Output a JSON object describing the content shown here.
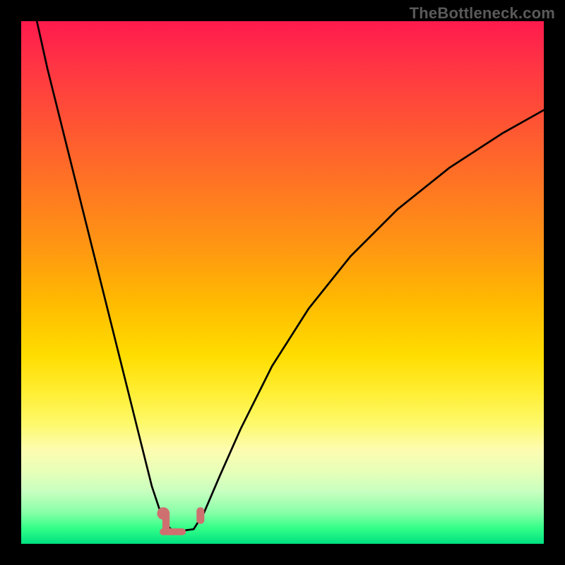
{
  "watermark": "TheBottleneck.com",
  "chart_data": {
    "type": "line",
    "title": "",
    "xlabel": "",
    "ylabel": "",
    "xlim": [
      0,
      100
    ],
    "ylim": [
      0,
      100
    ],
    "series": [
      {
        "name": "bottleneck-curve",
        "x": [
          3,
          5,
          8,
          11,
          14,
          17,
          20,
          23,
          25,
          27,
          28.5,
          30,
          31.5,
          33,
          35,
          38,
          42,
          48,
          55,
          63,
          72,
          82,
          92,
          100
        ],
        "y": [
          100,
          91,
          79,
          67,
          55,
          43,
          31,
          19,
          11,
          5,
          2.9,
          2.2,
          2.6,
          2.8,
          6,
          13,
          22,
          34,
          45,
          55,
          64,
          72,
          78.5,
          83
        ],
        "color": "#000000",
        "width": 2.7
      }
    ],
    "markers": [
      {
        "name": "left-edge-marker",
        "x": 27.2,
        "y": 5.8,
        "shape": "circle",
        "r": 1.2,
        "color": "#cf7070"
      },
      {
        "name": "bottom-horizontal",
        "x": 29.0,
        "y": 2.3,
        "shape": "bar-h",
        "w": 5.0,
        "h": 1.3,
        "color": "#cf7070"
      },
      {
        "name": "bottom-left-vertical",
        "x": 27.7,
        "y": 4.2,
        "shape": "bar-v",
        "w": 1.4,
        "h": 3.6,
        "color": "#cf7070"
      },
      {
        "name": "right-edge-marker",
        "x": 34.3,
        "y": 5.4,
        "shape": "bar-v",
        "w": 1.5,
        "h": 3.2,
        "color": "#cf7070"
      }
    ],
    "background_gradient": {
      "top": "#ff1a4d",
      "mid": "#ffdd00",
      "bottom": "#00e080"
    }
  }
}
